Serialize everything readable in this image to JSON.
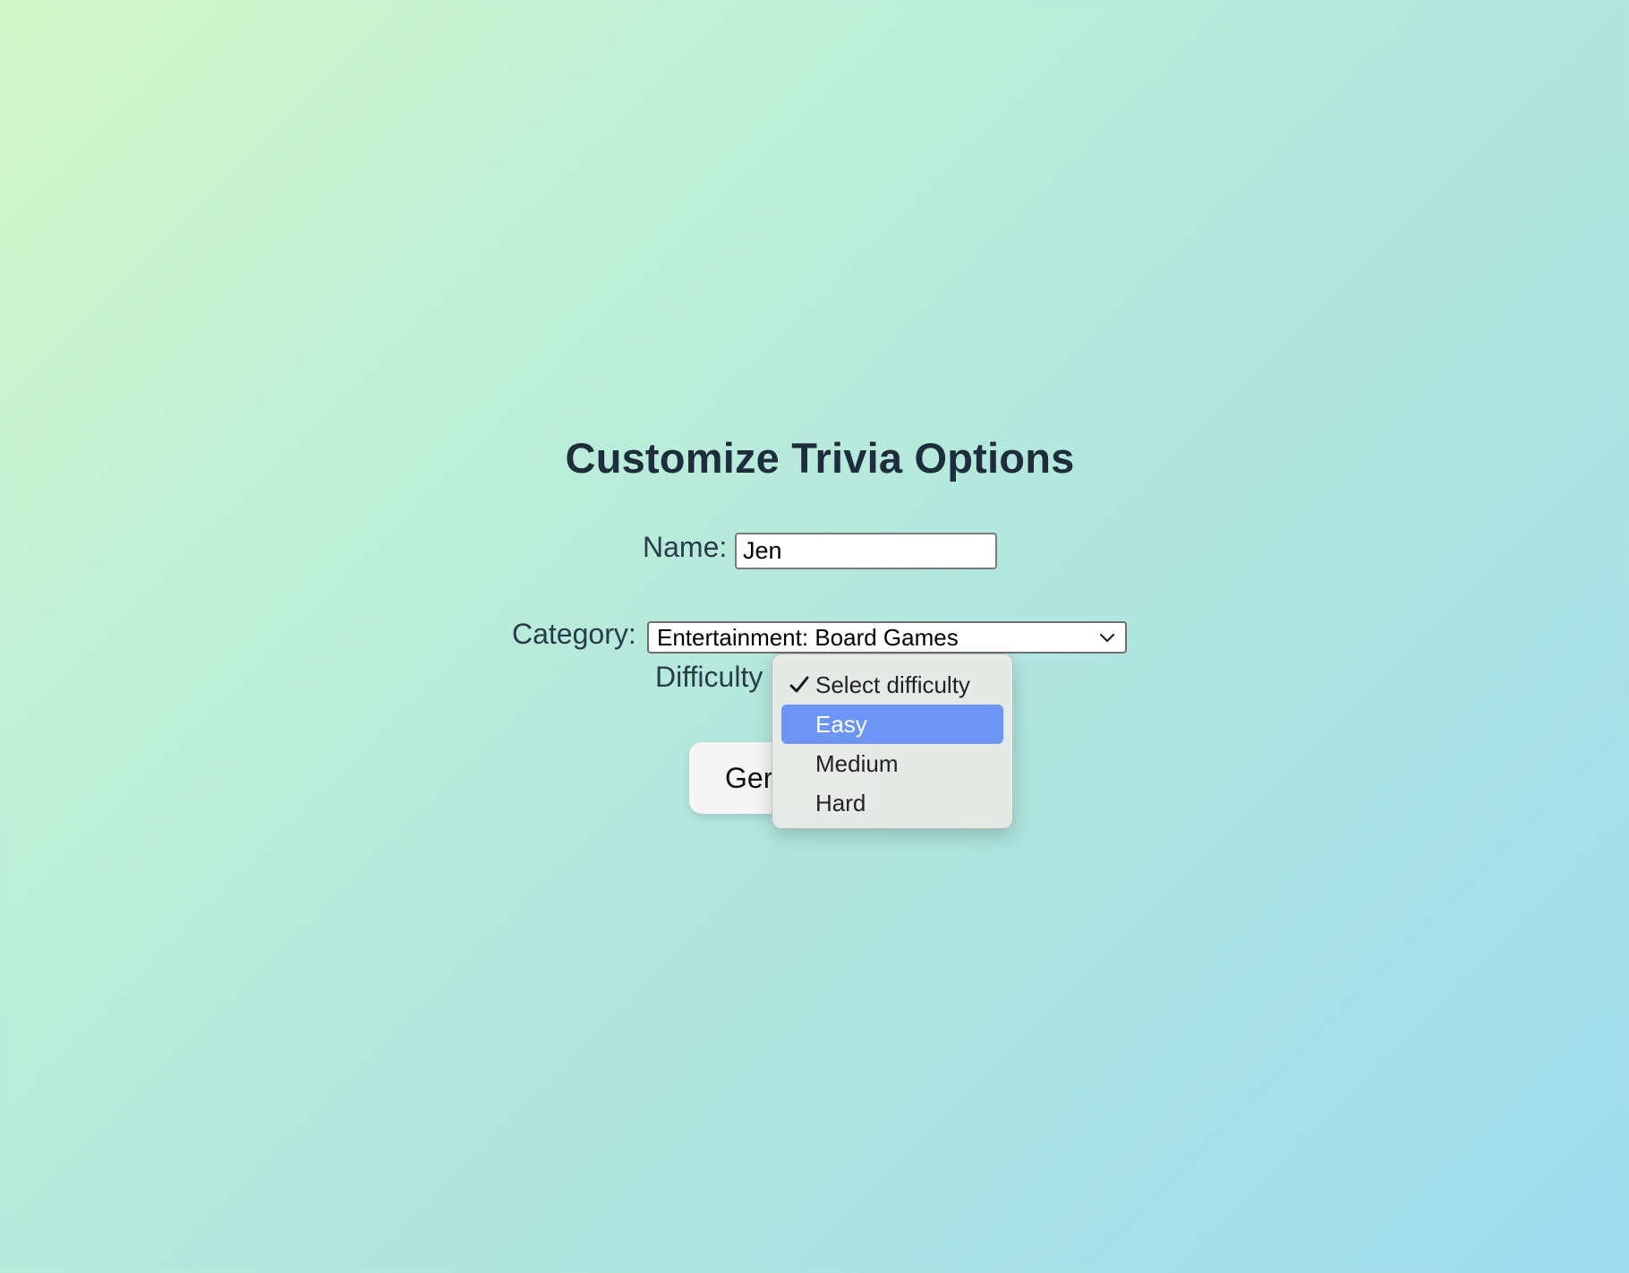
{
  "page": {
    "title": "Customize Trivia Options"
  },
  "form": {
    "name_label": "Name:",
    "name_value": "Jen",
    "category_label": "Category:",
    "category_selected": "Entertainment: Board Games",
    "difficulty_label": "Difficulty",
    "generate_button_visible_text": "Ger"
  },
  "difficulty_dropdown": {
    "options": [
      {
        "label": "Select difficulty",
        "checked": true,
        "highlighted": false
      },
      {
        "label": "Easy",
        "checked": false,
        "highlighted": true
      },
      {
        "label": "Medium",
        "checked": false,
        "highlighted": false
      },
      {
        "label": "Hard",
        "checked": false,
        "highlighted": false
      }
    ]
  },
  "colors": {
    "highlight": "#6c95f6",
    "title": "#1e2d3c"
  },
  "icons": {
    "select_chevron": "chevron-down-icon",
    "option_check": "checkmark-icon"
  }
}
